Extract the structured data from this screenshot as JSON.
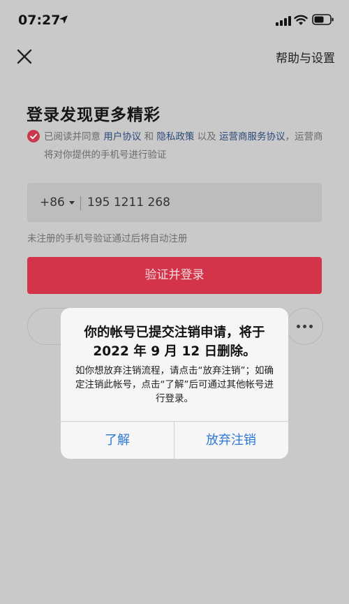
{
  "status_bar": {
    "time": "07:27"
  },
  "header": {
    "help_label": "帮助与设置"
  },
  "main": {
    "title": "登录发现更多精彩",
    "agreement": {
      "prefix": "已阅读并同意 ",
      "user_agreement": "用户协议",
      "and": " 和 ",
      "privacy_policy": "隐私政策",
      "and2": " 以及 ",
      "carrier_agreement": "运营商服务协议",
      "suffix": "，运营商将对你提供的手机号进行验证"
    },
    "phone": {
      "country_code": "+86",
      "number": "195 1211 268"
    },
    "hint": "未注册的手机号验证通过后将自动注册",
    "login_button": "验证并登录"
  },
  "dialog": {
    "title": "你的帐号已提交注销申请，将于 2022 年 9 月 12 日删除。",
    "message": "如你想放弃注销流程，请点击“放弃注销”；如确定注销此帐号，点击“了解”后可通过其他帐号进行登录。",
    "ok_button": "了解",
    "cancel_button": "放弃注销"
  }
}
